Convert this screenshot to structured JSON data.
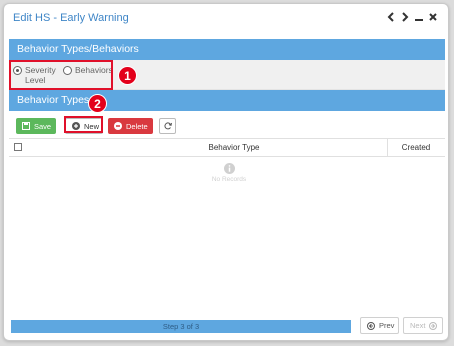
{
  "window": {
    "title": "Edit HS - Early Warning",
    "controls": [
      "chevron-left-icon",
      "chevron-right-icon",
      "minimize-icon",
      "close-icon"
    ]
  },
  "section1": {
    "header": "Behavior Types/Behaviors",
    "radio_options": [
      {
        "label": "Severity Level",
        "checked": true
      },
      {
        "label": "Behaviors",
        "checked": false
      }
    ]
  },
  "section2": {
    "header": "Behavior Types"
  },
  "toolbar": {
    "save_label": "Save",
    "new_label": "New",
    "delete_label": "Delete",
    "refresh_icon": "refresh-icon"
  },
  "grid": {
    "columns": [
      "Behavior Type",
      "Created"
    ],
    "empty_text": "No Records"
  },
  "callouts": [
    "1",
    "2"
  ],
  "footer": {
    "progress_text": "Step 3 of 3",
    "progress_fraction": 1.0,
    "prev_label": "Prev",
    "next_label": "Next"
  },
  "colors": {
    "header_blue": "#5ea7e0",
    "title_blue": "#3f86c7",
    "save_green": "#5cb85c",
    "delete_red": "#d9393f",
    "callout_red": "#e3001b"
  }
}
